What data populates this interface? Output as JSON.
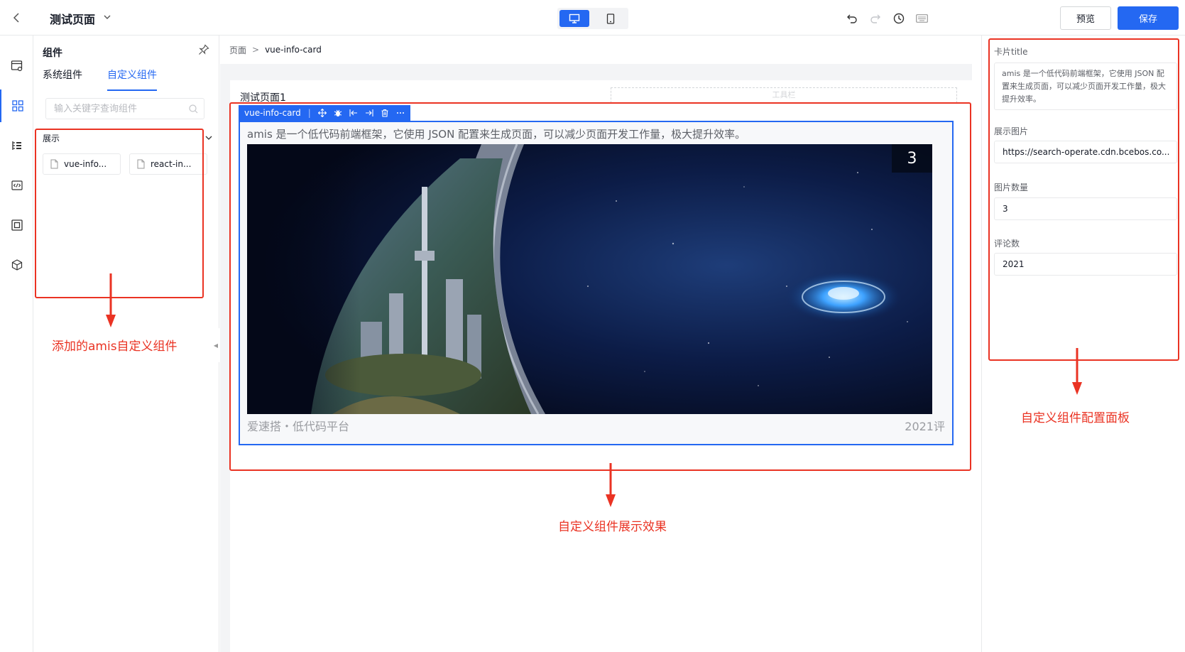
{
  "topbar": {
    "page_title": "测试页面",
    "preview_label": "预览",
    "save_label": "保存",
    "accent_color": "#2468f2"
  },
  "left_panel": {
    "title": "组件",
    "tabs": [
      {
        "label": "系统组件",
        "active": false
      },
      {
        "label": "自定义组件",
        "active": true
      }
    ],
    "search_placeholder": "输入关键字查询组件",
    "group_title": "展示",
    "components": [
      "vue-info...",
      "react-in..."
    ]
  },
  "canvas": {
    "breadcrumb": {
      "root": "页面",
      "separator": ">",
      "current": "vue-info-card"
    },
    "page_title": "测试页面1",
    "toolbar_placeholder": "工具栏",
    "selection_label": "vue-info-card",
    "card": {
      "description": "amis 是一个低代码前端框架，它使用 JSON 配置来生成页面，可以减少页面开发工作量，极大提升效率。",
      "image_count": "3",
      "footer_left": "爱速搭・低代码平台",
      "footer_right": "2021评"
    }
  },
  "config_panel": {
    "fields": [
      {
        "label": "卡片title",
        "value": "amis 是一个低代码前端框架，它使用 JSON 配置来生成页面，可以减少页面开发工作量，极大提升效率。"
      },
      {
        "label": "展示图片",
        "value": "https://search-operate.cdn.bcebos.co..."
      },
      {
        "label": "图片数量",
        "value": "3"
      },
      {
        "label": "评论数",
        "value": "2021"
      }
    ]
  },
  "annotations": {
    "left": "添加的amis自定义组件",
    "center": "自定义组件展示效果",
    "right": "自定义组件配置面板",
    "color": "#ea3323"
  }
}
